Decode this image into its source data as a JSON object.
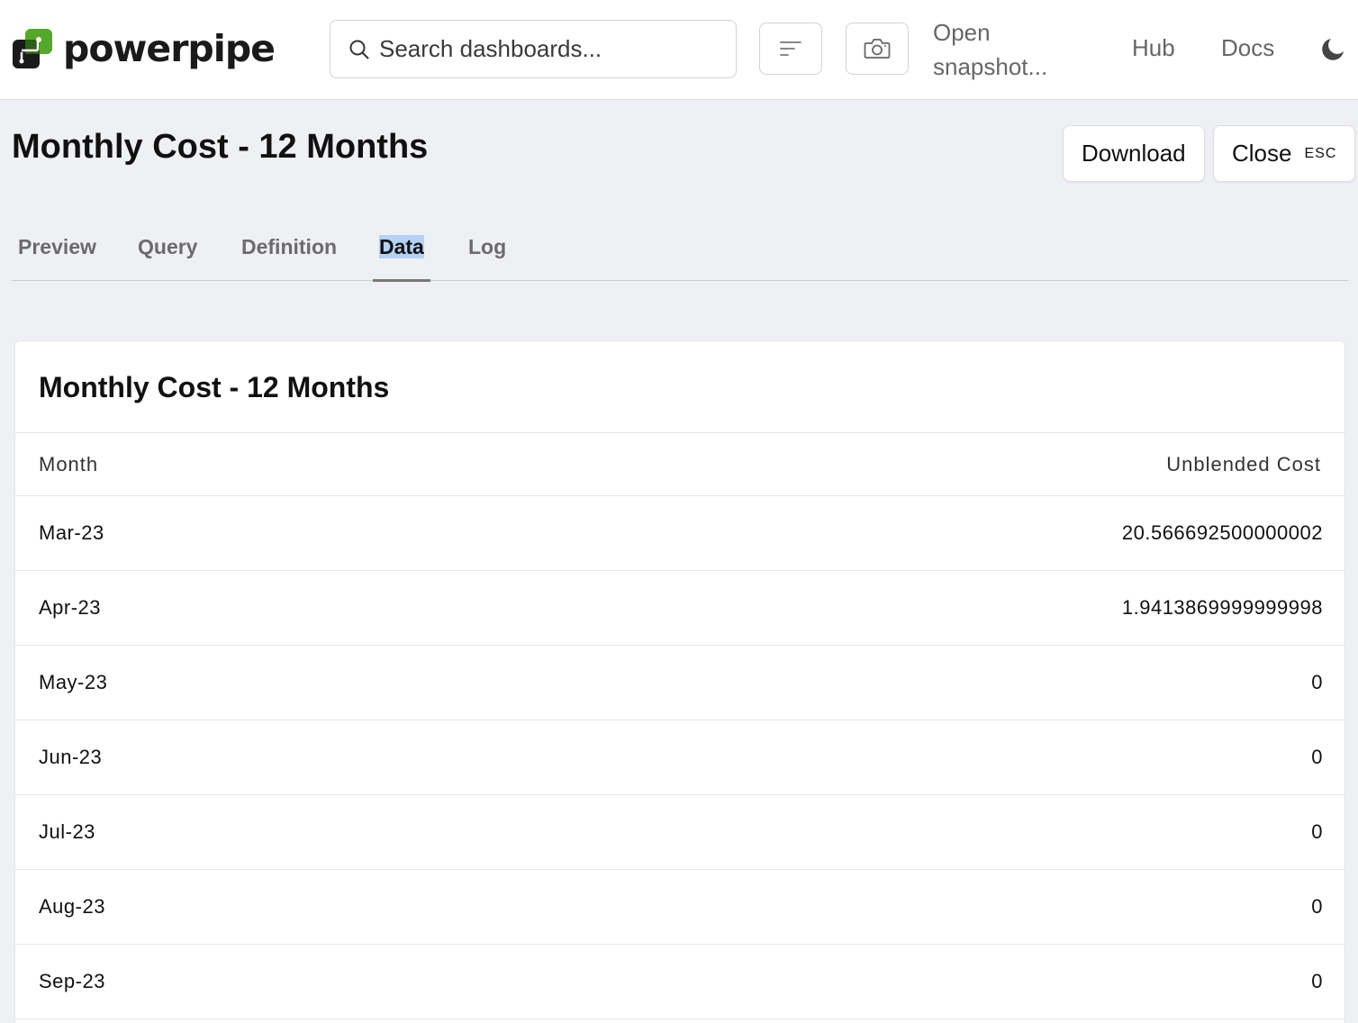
{
  "app": {
    "name": "powerpipe"
  },
  "header": {
    "search_placeholder": "Search dashboards...",
    "open_snapshot_line1": "Open",
    "open_snapshot_line2": "snapshot...",
    "nav": [
      {
        "label": "Hub"
      },
      {
        "label": "Docs"
      }
    ],
    "icons": [
      "filter-icon",
      "camera-icon",
      "moon-icon",
      "search-icon"
    ]
  },
  "page": {
    "title": "Monthly Cost - 12 Months",
    "download_label": "Download",
    "close_label": "Close",
    "close_shortcut": "ESC"
  },
  "tabs": [
    {
      "label": "Preview"
    },
    {
      "label": "Query"
    },
    {
      "label": "Definition"
    },
    {
      "label": "Data",
      "active": true
    },
    {
      "label": "Log"
    }
  ],
  "table": {
    "title": "Monthly Cost - 12 Months",
    "columns": [
      "Month",
      "Unblended Cost"
    ],
    "rows": [
      {
        "month": "Mar-23",
        "cost": "20.566692500000002"
      },
      {
        "month": "Apr-23",
        "cost": "1.9413869999999998"
      },
      {
        "month": "May-23",
        "cost": "0"
      },
      {
        "month": "Jun-23",
        "cost": "0"
      },
      {
        "month": "Jul-23",
        "cost": "0"
      },
      {
        "month": "Aug-23",
        "cost": "0"
      },
      {
        "month": "Sep-23",
        "cost": "0"
      }
    ]
  },
  "colors": {
    "brand_green": "#55a82a",
    "brand_dark": "#1a1a1a",
    "selection": "#b4d2f7"
  }
}
